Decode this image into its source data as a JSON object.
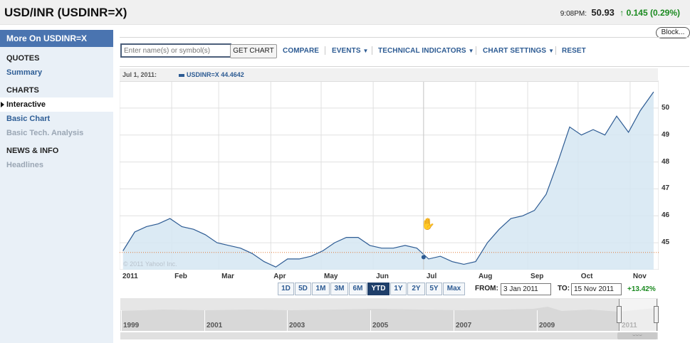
{
  "header": {
    "title": "USD/INR (USDINR=X)",
    "time": "9:08PM:",
    "price": "50.93",
    "change": "0.145 (0.29%)",
    "change_arrow": "up-arrow-icon",
    "block_label": "Block..."
  },
  "sidebar": {
    "header": "More On USDINR=X",
    "sections": [
      {
        "title": "QUOTES",
        "items": [
          {
            "label": "Summary",
            "state": "link"
          }
        ]
      },
      {
        "title": "CHARTS",
        "items": [
          {
            "label": "Interactive",
            "state": "active"
          },
          {
            "label": "Basic Chart",
            "state": "link"
          },
          {
            "label": "Basic Tech. Analysis",
            "state": "disabled"
          }
        ]
      },
      {
        "title": "NEWS & INFO",
        "items": [
          {
            "label": "Headlines",
            "state": "disabled"
          }
        ]
      }
    ]
  },
  "toolbar": {
    "search_placeholder": "Enter name(s) or symbol(s)",
    "get_chart": "GET CHART",
    "compare": "COMPARE",
    "events": "EVENTS",
    "technical_indicators": "TECHNICAL INDICATORS",
    "chart_settings": "CHART SETTINGS",
    "reset": "RESET"
  },
  "legend": {
    "date": "Jul 1, 2011:",
    "series": "USDINR=X 44.4642"
  },
  "copyright": "© 2011 Yahoo! Inc.",
  "range_buttons": [
    "1D",
    "5D",
    "1M",
    "3M",
    "6M",
    "YTD",
    "1Y",
    "2Y",
    "5Y",
    "Max"
  ],
  "selected_range": "YTD",
  "date_range": {
    "from_label": "FROM:",
    "from_value": "3 Jan 2011",
    "to_label": "TO:",
    "to_value": "15 Nov 2011",
    "change_pct": "+13.42%"
  },
  "navigator": {
    "years": [
      "1999",
      "2001",
      "2003",
      "2005",
      "2007",
      "2009",
      "2011"
    ],
    "scroll_grip": "⌣⌣⌣"
  },
  "colors": {
    "line": "#2d5b93",
    "area": "#d5e6f2",
    "accent": "#4a74b0",
    "positive": "#1b8a20",
    "reference_line": "#e07b39"
  },
  "chart_data": {
    "type": "area",
    "x_tick_labels": [
      "2011",
      "Feb",
      "Mar",
      "Apr",
      "May",
      "Jun",
      "Jul",
      "Aug",
      "Sep",
      "Oct",
      "Nov"
    ],
    "y_tick_labels": [
      "45",
      "46",
      "47",
      "48",
      "49",
      "50"
    ],
    "ylim": [
      44,
      51
    ],
    "grid": true,
    "reference_value": 44.64,
    "highlight": {
      "x": "Jul 1, 2011",
      "y": 44.4642
    },
    "series": [
      {
        "name": "USDINR=X",
        "x": [
          "2011-01-03",
          "2011-01-10",
          "2011-01-17",
          "2011-01-24",
          "2011-01-31",
          "2011-02-07",
          "2011-02-14",
          "2011-02-21",
          "2011-02-28",
          "2011-03-07",
          "2011-03-14",
          "2011-03-21",
          "2011-03-28",
          "2011-04-04",
          "2011-04-11",
          "2011-04-18",
          "2011-04-25",
          "2011-05-02",
          "2011-05-09",
          "2011-05-16",
          "2011-05-23",
          "2011-05-30",
          "2011-06-06",
          "2011-06-13",
          "2011-06-20",
          "2011-06-27",
          "2011-07-04",
          "2011-07-11",
          "2011-07-18",
          "2011-07-25",
          "2011-08-01",
          "2011-08-08",
          "2011-08-15",
          "2011-08-22",
          "2011-08-29",
          "2011-09-05",
          "2011-09-12",
          "2011-09-19",
          "2011-09-26",
          "2011-10-03",
          "2011-10-10",
          "2011-10-17",
          "2011-10-24",
          "2011-10-31",
          "2011-11-07",
          "2011-11-15"
        ],
        "y": [
          44.7,
          45.4,
          45.6,
          45.7,
          45.9,
          45.6,
          45.5,
          45.3,
          45.0,
          44.9,
          44.8,
          44.6,
          44.3,
          44.1,
          44.4,
          44.4,
          44.5,
          44.7,
          45.0,
          45.2,
          45.2,
          44.9,
          44.8,
          44.8,
          44.9,
          44.8,
          44.4,
          44.5,
          44.3,
          44.2,
          44.3,
          45.0,
          45.5,
          45.9,
          46.0,
          46.2,
          46.8,
          48.0,
          49.3,
          49.0,
          49.2,
          49.0,
          49.7,
          49.1,
          49.9,
          50.6
        ]
      }
    ]
  }
}
